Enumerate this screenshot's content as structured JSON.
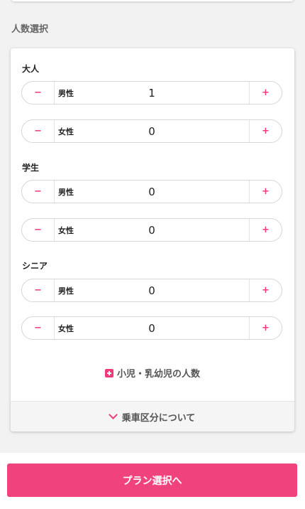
{
  "section_title": "人数選択",
  "accent_color": "#ef3b7c",
  "groups": [
    {
      "label": "大人",
      "rows": [
        {
          "gender": "男性",
          "value": "1"
        },
        {
          "gender": "女性",
          "value": "0"
        }
      ]
    },
    {
      "label": "学生",
      "rows": [
        {
          "gender": "男性",
          "value": "0"
        },
        {
          "gender": "女性",
          "value": "0"
        }
      ]
    },
    {
      "label": "シニア",
      "rows": [
        {
          "gender": "男性",
          "value": "0"
        },
        {
          "gender": "女性",
          "value": "0"
        }
      ]
    }
  ],
  "stepper": {
    "minus_label": "−",
    "plus_label": "+"
  },
  "child_link": {
    "label": "小児・乳幼児の人数",
    "icon": "plus-square-icon"
  },
  "footer_link": {
    "label": "乗車区分について",
    "icon": "chevron-down-icon"
  },
  "cta_label": "プラン選択へ"
}
